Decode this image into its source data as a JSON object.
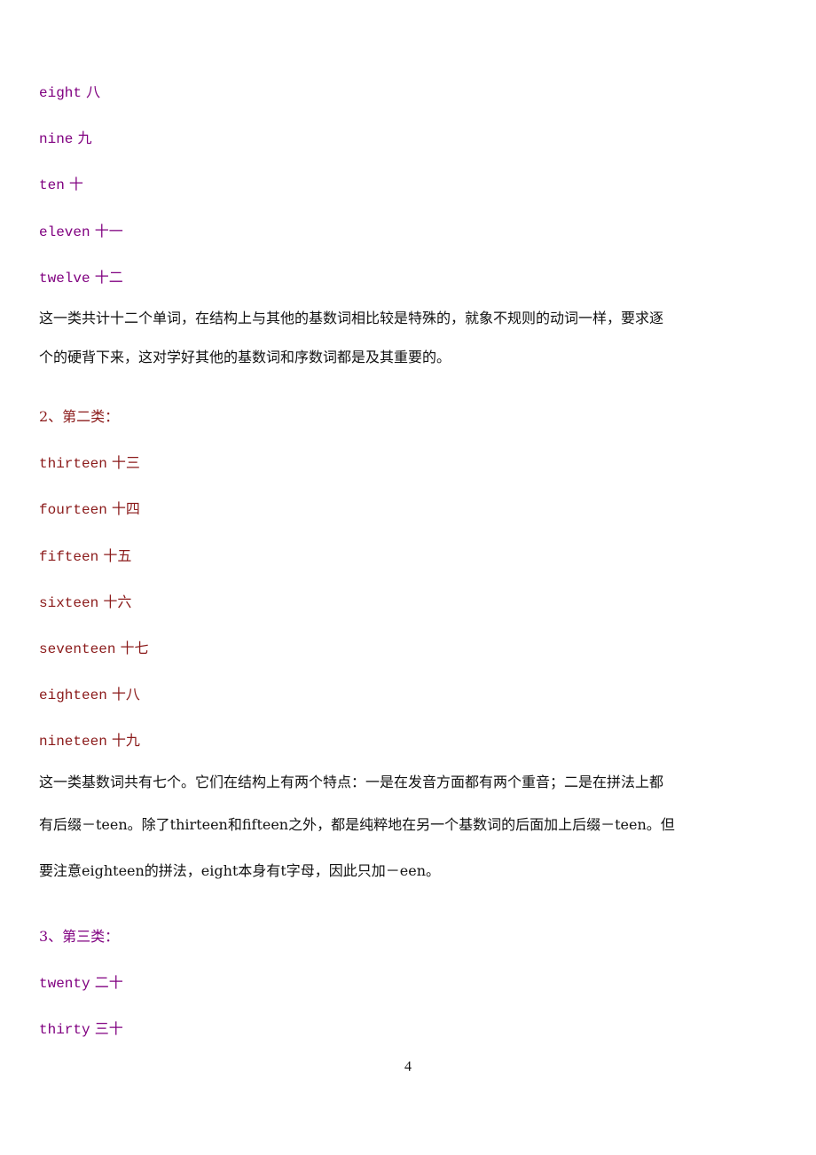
{
  "section1": {
    "items": [
      {
        "en": "eight",
        "zh": "八"
      },
      {
        "en": "nine",
        "zh": "九"
      },
      {
        "en": "ten",
        "zh": "十"
      },
      {
        "en": "eleven",
        "zh": "十一"
      },
      {
        "en": "twelve",
        "zh": "十二"
      }
    ],
    "note_lines": [
      "这一类共计十二个单词，在结构上与其他的基数词相比较是特殊的，就象不规则的动词一样，要求逐",
      "个的硬背下来，这对学好其他的基数词和序数词都是及其重要的。"
    ]
  },
  "section2": {
    "heading": "2、第二类：",
    "items": [
      {
        "en": "thirteen",
        "zh": "十三"
      },
      {
        "en": "fourteen",
        "zh": "十四"
      },
      {
        "en": "fifteen",
        "zh": "十五"
      },
      {
        "en": "sixteen",
        "zh": "十六"
      },
      {
        "en": "seventeen",
        "zh": "十七"
      },
      {
        "en": "eighteen",
        "zh": "十八"
      },
      {
        "en": "nineteen",
        "zh": "十九"
      }
    ],
    "note_lines": [
      "这一类基数词共有七个。它们在结构上有两个特点：一是在发音方面都有两个重音；二是在拼法上都",
      "有后缀－teen。除了thirteen和fifteen之外，都是纯粹地在另一个基数词的后面加上后缀－teen。但",
      "要注意eighteen的拼法，eight本身有t字母，因此只加－een。"
    ]
  },
  "section3": {
    "heading": "3、第三类：",
    "items": [
      {
        "en": "twenty",
        "zh": "二十"
      },
      {
        "en": "thirty",
        "zh": "三十"
      }
    ]
  },
  "page_number": "4",
  "colors": {
    "section1": "#800080",
    "section2": "#8b1a1a",
    "section3": "#800080",
    "body": "#111111"
  }
}
